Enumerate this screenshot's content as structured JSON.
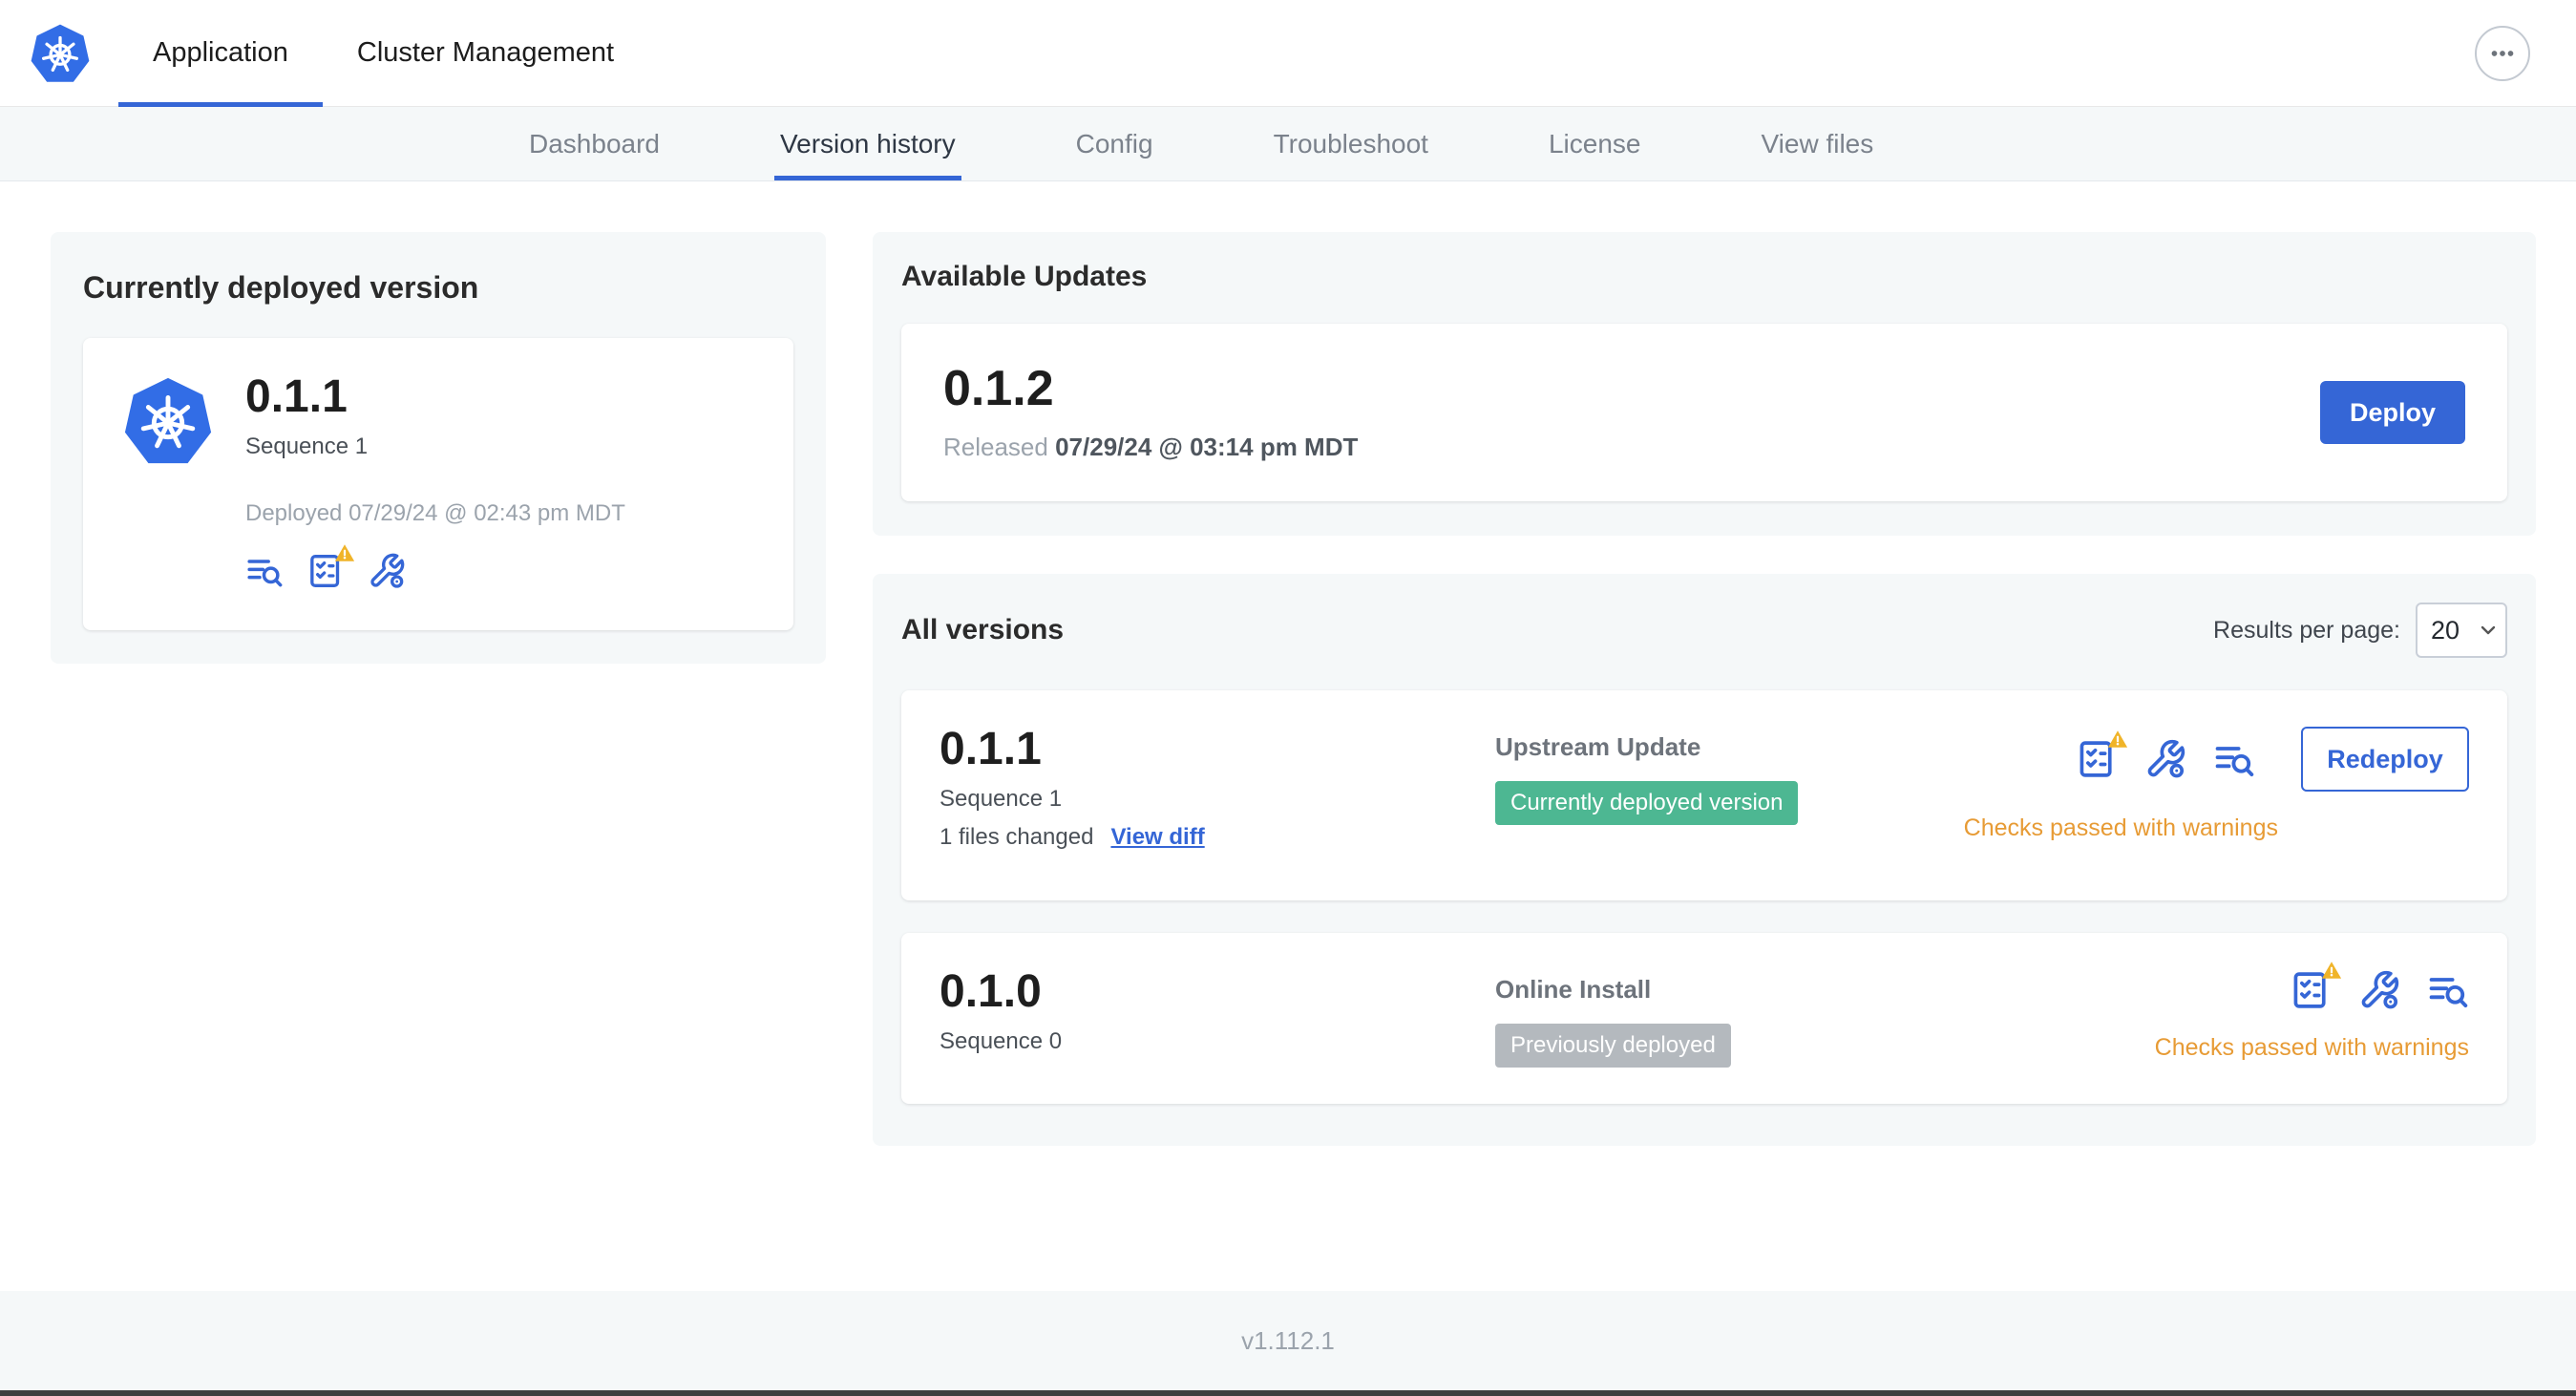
{
  "colors": {
    "accent": "#3566d6",
    "k8s_blue": "#326de6",
    "panel_bg": "#f5f8f9",
    "green_badge": "#4db792",
    "gray_badge": "#b4b9be",
    "warning_text": "#e79b35",
    "warning_triangle": "#f0b429"
  },
  "topnav": {
    "tabs": [
      {
        "label": "Application"
      },
      {
        "label": "Cluster Management"
      }
    ]
  },
  "subnav": {
    "active": "Version history",
    "items": [
      {
        "label": "Dashboard"
      },
      {
        "label": "Version history"
      },
      {
        "label": "Config"
      },
      {
        "label": "Troubleshoot"
      },
      {
        "label": "License"
      },
      {
        "label": "View files"
      }
    ]
  },
  "current_version": {
    "title": "Currently deployed version",
    "version": "0.1.1",
    "sequence": "Sequence 1",
    "deployed": "Deployed 07/29/24 @ 02:43 pm MDT"
  },
  "available_updates": {
    "title": "Available Updates",
    "version": "0.1.2",
    "released_label": "Released",
    "released_date": "07/29/24 @ 03:14 pm MDT",
    "deploy_button": "Deploy"
  },
  "all_versions": {
    "title": "All versions",
    "results_per_page_label": "Results per page:",
    "results_per_page_value": "20",
    "rows": [
      {
        "version": "0.1.1",
        "sequence": "Sequence 1",
        "files_changed": "1 files changed",
        "view_diff_link": "View diff",
        "source": "Upstream Update",
        "badge": "Currently deployed version",
        "action_button": "Redeploy",
        "status": "Checks passed with warnings"
      },
      {
        "version": "0.1.0",
        "sequence": "Sequence 0",
        "source": "Online Install",
        "badge": "Previously deployed",
        "status": "Checks passed with warnings"
      }
    ]
  },
  "footer": {
    "app_version": "v1.112.1"
  }
}
